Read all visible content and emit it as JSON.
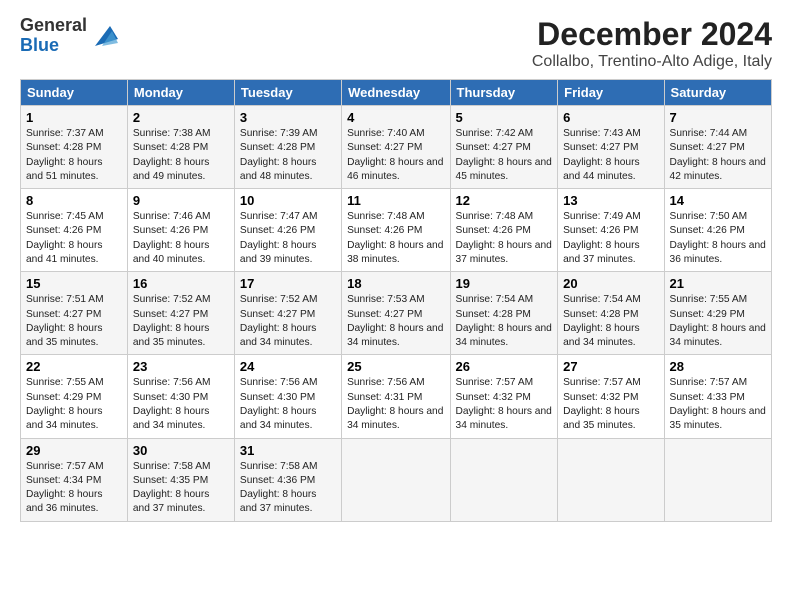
{
  "logo": {
    "line1": "General",
    "line2": "Blue"
  },
  "title": "December 2024",
  "subtitle": "Collalbo, Trentino-Alto Adige, Italy",
  "weekdays": [
    "Sunday",
    "Monday",
    "Tuesday",
    "Wednesday",
    "Thursday",
    "Friday",
    "Saturday"
  ],
  "weeks": [
    [
      {
        "day": "1",
        "sunrise": "7:37 AM",
        "sunset": "4:28 PM",
        "daylight": "8 hours and 51 minutes."
      },
      {
        "day": "2",
        "sunrise": "7:38 AM",
        "sunset": "4:28 PM",
        "daylight": "8 hours and 49 minutes."
      },
      {
        "day": "3",
        "sunrise": "7:39 AM",
        "sunset": "4:28 PM",
        "daylight": "8 hours and 48 minutes."
      },
      {
        "day": "4",
        "sunrise": "7:40 AM",
        "sunset": "4:27 PM",
        "daylight": "8 hours and 46 minutes."
      },
      {
        "day": "5",
        "sunrise": "7:42 AM",
        "sunset": "4:27 PM",
        "daylight": "8 hours and 45 minutes."
      },
      {
        "day": "6",
        "sunrise": "7:43 AM",
        "sunset": "4:27 PM",
        "daylight": "8 hours and 44 minutes."
      },
      {
        "day": "7",
        "sunrise": "7:44 AM",
        "sunset": "4:27 PM",
        "daylight": "8 hours and 42 minutes."
      }
    ],
    [
      {
        "day": "8",
        "sunrise": "7:45 AM",
        "sunset": "4:26 PM",
        "daylight": "8 hours and 41 minutes."
      },
      {
        "day": "9",
        "sunrise": "7:46 AM",
        "sunset": "4:26 PM",
        "daylight": "8 hours and 40 minutes."
      },
      {
        "day": "10",
        "sunrise": "7:47 AM",
        "sunset": "4:26 PM",
        "daylight": "8 hours and 39 minutes."
      },
      {
        "day": "11",
        "sunrise": "7:48 AM",
        "sunset": "4:26 PM",
        "daylight": "8 hours and 38 minutes."
      },
      {
        "day": "12",
        "sunrise": "7:48 AM",
        "sunset": "4:26 PM",
        "daylight": "8 hours and 37 minutes."
      },
      {
        "day": "13",
        "sunrise": "7:49 AM",
        "sunset": "4:26 PM",
        "daylight": "8 hours and 37 minutes."
      },
      {
        "day": "14",
        "sunrise": "7:50 AM",
        "sunset": "4:26 PM",
        "daylight": "8 hours and 36 minutes."
      }
    ],
    [
      {
        "day": "15",
        "sunrise": "7:51 AM",
        "sunset": "4:27 PM",
        "daylight": "8 hours and 35 minutes."
      },
      {
        "day": "16",
        "sunrise": "7:52 AM",
        "sunset": "4:27 PM",
        "daylight": "8 hours and 35 minutes."
      },
      {
        "day": "17",
        "sunrise": "7:52 AM",
        "sunset": "4:27 PM",
        "daylight": "8 hours and 34 minutes."
      },
      {
        "day": "18",
        "sunrise": "7:53 AM",
        "sunset": "4:27 PM",
        "daylight": "8 hours and 34 minutes."
      },
      {
        "day": "19",
        "sunrise": "7:54 AM",
        "sunset": "4:28 PM",
        "daylight": "8 hours and 34 minutes."
      },
      {
        "day": "20",
        "sunrise": "7:54 AM",
        "sunset": "4:28 PM",
        "daylight": "8 hours and 34 minutes."
      },
      {
        "day": "21",
        "sunrise": "7:55 AM",
        "sunset": "4:29 PM",
        "daylight": "8 hours and 34 minutes."
      }
    ],
    [
      {
        "day": "22",
        "sunrise": "7:55 AM",
        "sunset": "4:29 PM",
        "daylight": "8 hours and 34 minutes."
      },
      {
        "day": "23",
        "sunrise": "7:56 AM",
        "sunset": "4:30 PM",
        "daylight": "8 hours and 34 minutes."
      },
      {
        "day": "24",
        "sunrise": "7:56 AM",
        "sunset": "4:30 PM",
        "daylight": "8 hours and 34 minutes."
      },
      {
        "day": "25",
        "sunrise": "7:56 AM",
        "sunset": "4:31 PM",
        "daylight": "8 hours and 34 minutes."
      },
      {
        "day": "26",
        "sunrise": "7:57 AM",
        "sunset": "4:32 PM",
        "daylight": "8 hours and 34 minutes."
      },
      {
        "day": "27",
        "sunrise": "7:57 AM",
        "sunset": "4:32 PM",
        "daylight": "8 hours and 35 minutes."
      },
      {
        "day": "28",
        "sunrise": "7:57 AM",
        "sunset": "4:33 PM",
        "daylight": "8 hours and 35 minutes."
      }
    ],
    [
      {
        "day": "29",
        "sunrise": "7:57 AM",
        "sunset": "4:34 PM",
        "daylight": "8 hours and 36 minutes."
      },
      {
        "day": "30",
        "sunrise": "7:58 AM",
        "sunset": "4:35 PM",
        "daylight": "8 hours and 37 minutes."
      },
      {
        "day": "31",
        "sunrise": "7:58 AM",
        "sunset": "4:36 PM",
        "daylight": "8 hours and 37 minutes."
      },
      null,
      null,
      null,
      null
    ]
  ]
}
